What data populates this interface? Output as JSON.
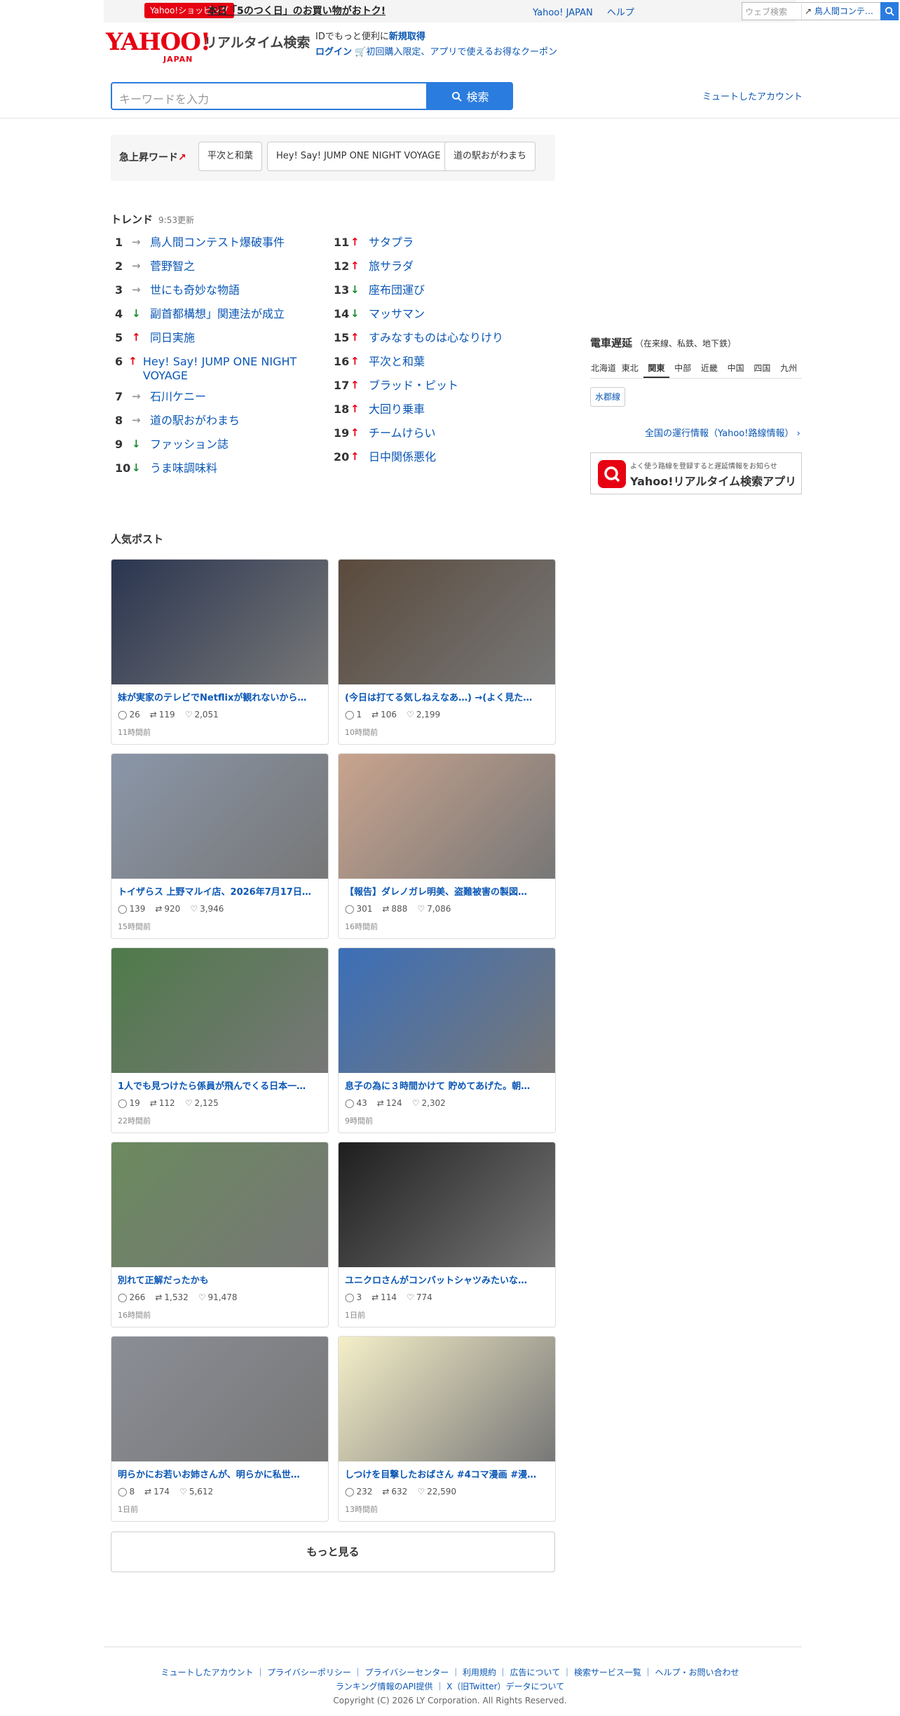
{
  "promo": {
    "tag": "Yahoo!ショッピング",
    "text": "本日「5のつく日」のお買い物がおトク!",
    "links": [
      "Yahoo! JAPAN",
      "ヘルプ"
    ],
    "search_placeholder": "ウェブ検索",
    "search_trend": "鳥人間コンテ…"
  },
  "header": {
    "logo": "YAHOO!",
    "logo_sub": "JAPAN",
    "service": "リアルタイム検索",
    "id_line1_pre": "IDでもっと便利に",
    "id_line1_link": "新規取得",
    "id_line2_link": "ログイン",
    "id_line2_text": "初回購入限定、アプリで使えるお得なクーポン"
  },
  "search": {
    "placeholder": "キーワードを入力",
    "button": "検索",
    "muted": "ミュートしたアカウント"
  },
  "rising": {
    "label": "急上昇ワード",
    "words": [
      "平次と和葉",
      "Hey! Say! JUMP ONE NIGHT VOYAGE",
      "道の駅おがわまち"
    ]
  },
  "trend": {
    "title": "トレンド",
    "updated": "9:53更新",
    "left": [
      {
        "rank": "1",
        "dir": "st",
        "word": "鳥人間コンテスト爆破事件"
      },
      {
        "rank": "2",
        "dir": "st",
        "word": "菅野智之"
      },
      {
        "rank": "3",
        "dir": "st",
        "word": "世にも奇妙な物語"
      },
      {
        "rank": "4",
        "dir": "dn",
        "word": "副首都構想」関連法が成立"
      },
      {
        "rank": "5",
        "dir": "up",
        "word": "同日実施"
      },
      {
        "rank": "6",
        "dir": "up",
        "word": "Hey! Say! JUMP ONE NIGHT VOYAGE"
      },
      {
        "rank": "7",
        "dir": "st",
        "word": "石川ケニー"
      },
      {
        "rank": "8",
        "dir": "st",
        "word": "道の駅おがわまち"
      },
      {
        "rank": "9",
        "dir": "dn",
        "word": "ファッション誌"
      },
      {
        "rank": "10",
        "dir": "dn",
        "word": "うま味調味料"
      }
    ],
    "right": [
      {
        "rank": "11",
        "dir": "up",
        "word": "サタプラ"
      },
      {
        "rank": "12",
        "dir": "up",
        "word": "旅サラダ"
      },
      {
        "rank": "13",
        "dir": "dn",
        "word": "座布団運び"
      },
      {
        "rank": "14",
        "dir": "dn",
        "word": "マッサマン"
      },
      {
        "rank": "15",
        "dir": "up",
        "word": "すみなすものは心なりけり"
      },
      {
        "rank": "16",
        "dir": "up",
        "word": "平次と和葉"
      },
      {
        "rank": "17",
        "dir": "up",
        "word": "ブラッド・ピット"
      },
      {
        "rank": "18",
        "dir": "up",
        "word": "大回り乗車"
      },
      {
        "rank": "19",
        "dir": "up",
        "word": "チームけらい"
      },
      {
        "rank": "20",
        "dir": "up",
        "word": "日中関係悪化"
      }
    ]
  },
  "train": {
    "title": "電車遅延",
    "sub": "（在来線、私鉄、地下鉄）",
    "regions": [
      "北海道",
      "東北",
      "関東",
      "中部",
      "近畿",
      "中国",
      "四国",
      "九州"
    ],
    "active_region": "関東",
    "line": "水郡線",
    "link": "全国の運行情報（Yahoo!路線情報）",
    "app_small": "よく使う路線を登録すると遅延情報をお知らせ",
    "app_big": "Yahoo!リアルタイム検索アプリ"
  },
  "posts": {
    "title": "人気ポスト",
    "items": [
      {
        "title": "妹が実家のテレビでNetflixが観れないから…",
        "replies": "26",
        "reposts": "119",
        "likes": "2,051",
        "time": "11時間前",
        "color": "#2a3550"
      },
      {
        "title": "(今日は打てる気しねえなあ…) →(よく見た…",
        "replies": "1",
        "reposts": "106",
        "likes": "2,199",
        "time": "10時間前",
        "color": "#5a4a3c"
      },
      {
        "title": "トイザらス 上野マルイ店、2026年7月17日…",
        "replies": "139",
        "reposts": "920",
        "likes": "3,946",
        "time": "15時間前",
        "color": "#8a96a8"
      },
      {
        "title": "【報告】ダレノガレ明美、盗難被害の製図…",
        "replies": "301",
        "reposts": "888",
        "likes": "7,086",
        "time": "16時間前",
        "color": "#c9a48e"
      },
      {
        "title": "1人でも見つけたら係員が飛んでくる日本一…",
        "replies": "19",
        "reposts": "112",
        "likes": "2,125",
        "time": "22時間前",
        "color": "#4f7a4a"
      },
      {
        "title": "息子の為に３時間かけて 貯めてあげた。朝…",
        "replies": "43",
        "reposts": "124",
        "likes": "2,302",
        "time": "9時間前",
        "color": "#3b6fb8"
      },
      {
        "title": "別れて正解だったかも",
        "replies": "266",
        "reposts": "1,532",
        "likes": "91,478",
        "time": "16時間前",
        "color": "#6b8a5e"
      },
      {
        "title": "ユニクロさんがコンバットシャツみたいな…",
        "replies": "3",
        "reposts": "114",
        "likes": "774",
        "time": "1日前",
        "color": "#1e1e1e"
      },
      {
        "title": "明らかにお若いお姉さんが、明らかに私世…",
        "replies": "8",
        "reposts": "174",
        "likes": "5,612",
        "time": "1日前",
        "color": "#8b8e96"
      },
      {
        "title": "しつけを目撃したおばさん #4コマ漫画 #漫…",
        "replies": "232",
        "reposts": "632",
        "likes": "22,590",
        "time": "13時間前",
        "color": "#f5efc8"
      }
    ],
    "more": "もっと見る"
  },
  "footer": {
    "line1": "ミュートしたアカウント ｜ プライバシーポリシー ｜ プライバシーセンター ｜ 利用規約 ｜ 広告について ｜ 検索サービス一覧 ｜ ヘルプ・お問い合わせ",
    "line2": "ランキング情報のAPI提供 ｜ X（旧Twitter）データについて",
    "copyright": "Copyright (C) 2026 LY Corporation. All Rights Reserved."
  }
}
